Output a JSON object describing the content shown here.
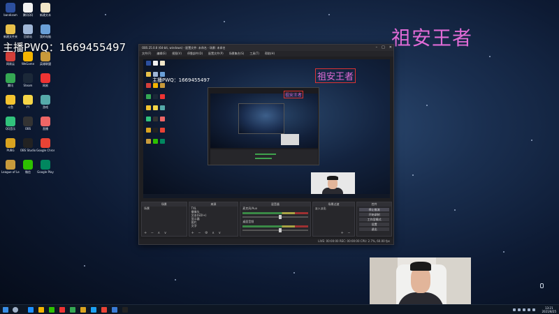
{
  "overlay": {
    "streamer_id": "主播PWQ：1669455497",
    "title_text": "祖安王者"
  },
  "desktop_icons": [
    {
      "label": "bandizam",
      "icon": "bandicam-icon",
      "color": "#2c4f9e"
    },
    {
      "label": "腾讯QQ",
      "icon": "penguin-icon",
      "color": "#f2f2f2"
    },
    {
      "label": "新建文本",
      "icon": "document-icon",
      "color": "#f0e6c8"
    },
    {
      "label": "新建文件夹",
      "icon": "folder-icon",
      "color": "#e8c04a"
    },
    {
      "label": "回收站",
      "icon": "recycle-bin-icon",
      "color": "#9fb6d6"
    },
    {
      "label": "我的电脑",
      "icon": "computer-icon",
      "color": "#6aa0d8"
    },
    {
      "label": "网易云",
      "icon": "music-icon",
      "color": "#d43f3a"
    },
    {
      "label": "WeGame",
      "icon": "wegame-icon",
      "color": "#f4b400"
    },
    {
      "label": "英雄联盟",
      "icon": "lol-icon",
      "color": "#c99a3a"
    },
    {
      "label": "腾讯",
      "icon": "tencent-icon",
      "color": "#35a853"
    },
    {
      "label": "Steam",
      "icon": "steam-icon",
      "color": "#1b2838"
    },
    {
      "label": "网易",
      "icon": "netease-icon",
      "color": "#e33"
    },
    {
      "label": "斗鱼",
      "icon": "douyu-icon",
      "color": "#f4c430"
    },
    {
      "label": "YY",
      "icon": "yy-icon",
      "color": "#f5d547"
    },
    {
      "label": "游戏",
      "icon": "game-icon",
      "color": "#5aa"
    },
    {
      "label": "QQ音乐",
      "icon": "qq-music-icon",
      "color": "#31c27c"
    },
    {
      "label": "OBS",
      "icon": "obs-icon",
      "color": "#333"
    },
    {
      "label": "直播",
      "icon": "live-icon",
      "color": "#e66"
    },
    {
      "label": "PUBG",
      "icon": "pubg-icon",
      "color": "#d9a320"
    },
    {
      "label": "OBS Studio",
      "icon": "obs-studio-icon",
      "color": "#222"
    },
    {
      "label": "Google Chrome",
      "icon": "chrome-icon",
      "color": "#e94335"
    },
    {
      "label": "League of Legends",
      "icon": "lol-client-icon",
      "color": "#c89b3c"
    },
    {
      "label": "微信",
      "icon": "wechat-icon",
      "color": "#2dc100"
    },
    {
      "label": "Google Play",
      "icon": "play-icon",
      "color": "#01875f"
    }
  ],
  "obs": {
    "title": "OBS 25.0.8 (64-bit, windows) - 配置文件: 未命名 - 场景: 未命名",
    "menu": [
      "文件(F)",
      "编辑(E)",
      "视图(V)",
      "停靠部件(D)",
      "配置文件(P)",
      "场景集合(S)",
      "工具(T)",
      "帮助(H)"
    ],
    "docks": {
      "scenes_header": "场景",
      "scenes": [
        "场景"
      ],
      "sources_header": "来源",
      "sources": [
        "TXL",
        "摄像头",
        "文本(GDI+)",
        "显示器",
        "图片",
        "文字"
      ],
      "mixer_header": "混音器",
      "mixer_channels": [
        "麦克风/Aux",
        "桌面音频"
      ],
      "transitions_header": "场景过渡",
      "transition_value": "淡入淡出",
      "controls_header": "控件",
      "controls": [
        "停止推流",
        "开始录制",
        "工作室模式",
        "设置",
        "退出"
      ]
    },
    "status": "LIVE: 00:00:00   REC: 00:00:00   CPU: 2.7%, 60.00 fps"
  },
  "taskbar": {
    "time": "13:21",
    "date": "2021/8/25",
    "pinned_colors": [
      "#1e90ff",
      "#f4b400",
      "#2dc100",
      "#e33",
      "#35a853",
      "#d9a320",
      "#1da1f2",
      "#e94335",
      "#3a7bd5",
      "#222"
    ]
  }
}
